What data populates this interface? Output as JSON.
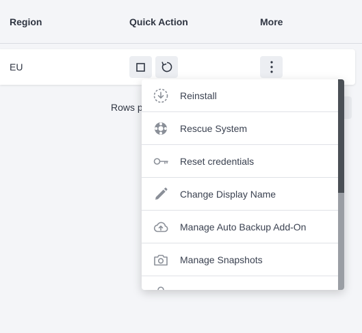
{
  "table": {
    "headers": {
      "region": "Region",
      "quick_action": "Quick Action",
      "more": "More"
    },
    "row": {
      "region": "EU",
      "more_glyph": "⋮"
    }
  },
  "pager": {
    "rows_label": "Rows p"
  },
  "menu": {
    "items": [
      {
        "label": "Reinstall",
        "icon": "reinstall-icon"
      },
      {
        "label": "Rescue System",
        "icon": "lifebuoy-icon"
      },
      {
        "label": "Reset credentials",
        "icon": "key-icon"
      },
      {
        "label": "Change Display Name",
        "icon": "pencil-icon"
      },
      {
        "label": "Manage Auto Backup Add-On",
        "icon": "cloud-upload-icon"
      },
      {
        "label": "Manage Snapshots",
        "icon": "camera-icon"
      }
    ]
  },
  "colors": {
    "background": "#f4f5f8",
    "icon_gray": "#8a8f98",
    "text": "#2f3542"
  }
}
